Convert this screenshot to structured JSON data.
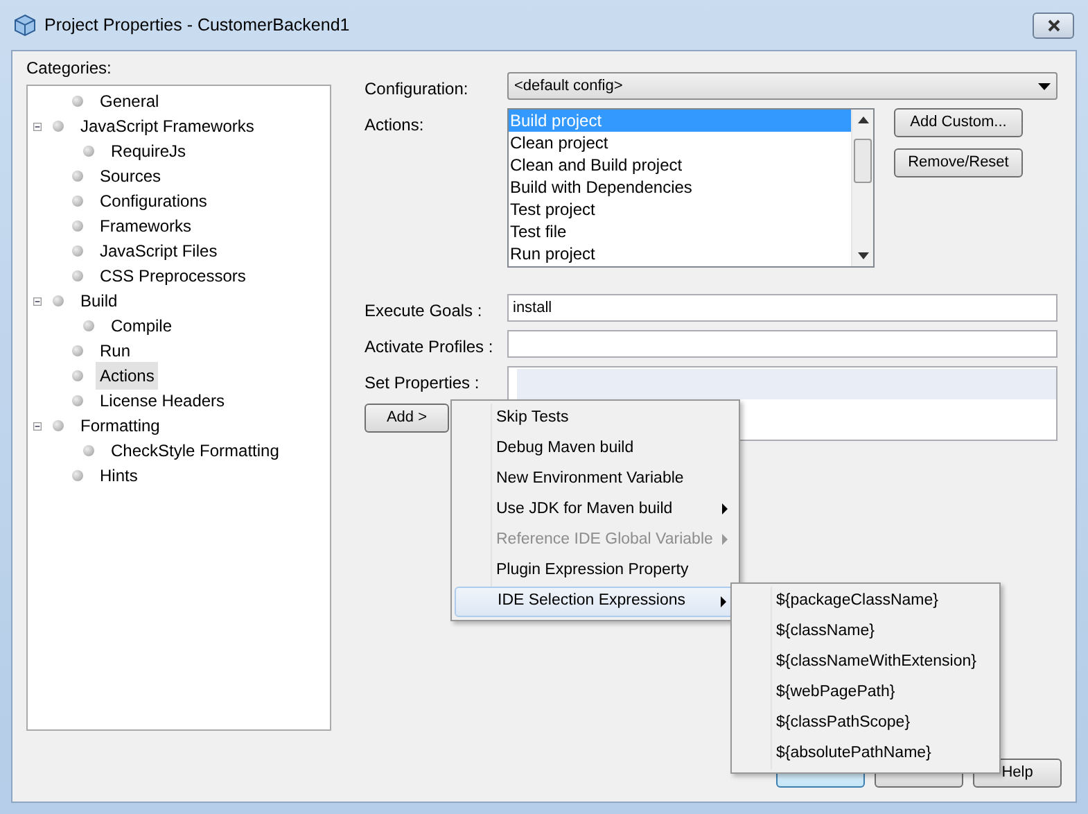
{
  "window": {
    "title": "Project Properties - CustomerBackend1"
  },
  "categories": {
    "label": "Categories:",
    "items": [
      {
        "label": "General",
        "selected": false
      },
      {
        "label": "JavaScript Frameworks",
        "selected": false,
        "expanded": true,
        "children": [
          {
            "label": "RequireJs",
            "selected": false
          }
        ]
      },
      {
        "label": "Sources",
        "selected": false
      },
      {
        "label": "Configurations",
        "selected": false
      },
      {
        "label": "Frameworks",
        "selected": false
      },
      {
        "label": "JavaScript Files",
        "selected": false
      },
      {
        "label": "CSS Preprocessors",
        "selected": false
      },
      {
        "label": "Build",
        "selected": false,
        "expanded": true,
        "children": [
          {
            "label": "Compile",
            "selected": false
          }
        ]
      },
      {
        "label": "Run",
        "selected": false
      },
      {
        "label": "Actions",
        "selected": true
      },
      {
        "label": "License Headers",
        "selected": false
      },
      {
        "label": "Formatting",
        "selected": false,
        "expanded": true,
        "children": [
          {
            "label": "CheckStyle Formatting",
            "selected": false
          }
        ]
      },
      {
        "label": "Hints",
        "selected": false
      }
    ]
  },
  "configuration": {
    "label": "Configuration:",
    "value": "<default config>"
  },
  "actions": {
    "label": "Actions:",
    "items": [
      {
        "label": "Build project",
        "selected": true
      },
      {
        "label": "Clean project",
        "selected": false
      },
      {
        "label": "Clean and Build project",
        "selected": false
      },
      {
        "label": "Build with Dependencies",
        "selected": false
      },
      {
        "label": "Test project",
        "selected": false
      },
      {
        "label": "Test file",
        "selected": false
      },
      {
        "label": "Run project",
        "selected": false
      }
    ],
    "buttons": [
      "Add Custom...",
      "Remove/Reset"
    ]
  },
  "execute_goals": {
    "label": "Execute Goals :",
    "value": "install"
  },
  "activate_profiles": {
    "label": "Activate Profiles :"
  },
  "set_properties": {
    "label": "Set Properties :"
  },
  "add_button": "Add >",
  "add_menu": [
    {
      "label": "Skip Tests",
      "kind": "item",
      "disabled": false,
      "selected": false
    },
    {
      "label": "Debug Maven build",
      "kind": "item",
      "disabled": false,
      "selected": false
    },
    {
      "label": "New Environment Variable",
      "kind": "item",
      "disabled": false,
      "selected": false
    },
    {
      "label": "Use JDK for Maven build",
      "kind": "submenu",
      "disabled": false,
      "selected": false
    },
    {
      "label": "Reference IDE Global Variable",
      "kind": "submenu",
      "disabled": true,
      "selected": false
    },
    {
      "label": "Plugin Expression Property",
      "kind": "item",
      "disabled": false,
      "selected": false
    },
    {
      "label": "IDE Selection Expressions",
      "kind": "submenu",
      "disabled": false,
      "selected": true
    }
  ],
  "submenu": [
    "${packageClassName}",
    "${className}",
    "${classNameWithExtension}",
    "${webPagePath}",
    "${classPathScope}",
    "${absolutePathName}"
  ],
  "footer_buttons": [
    {
      "default": true
    },
    {
      "default": false
    },
    {
      "label": "Help",
      "default": false
    }
  ]
}
